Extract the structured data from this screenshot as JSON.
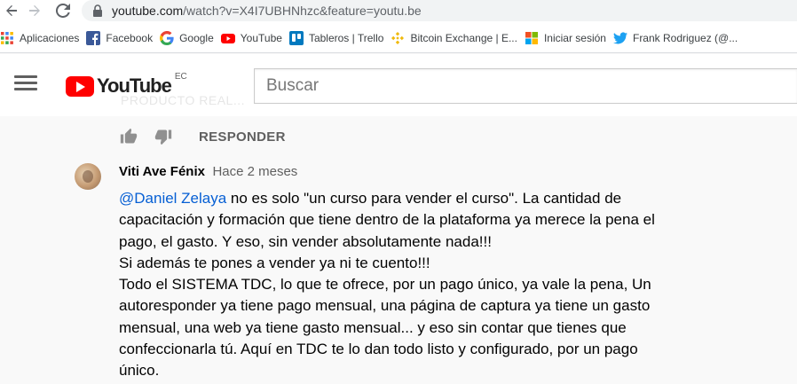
{
  "browser": {
    "url_host": "youtube.com",
    "url_path": "/watch?v=X4I7UBHNhzc&feature=youtu.be"
  },
  "bookmarks": [
    {
      "label": "Aplicaciones",
      "icon": "apps-grid-icon"
    },
    {
      "label": "Facebook",
      "icon": "facebook-icon"
    },
    {
      "label": "Google",
      "icon": "google-icon"
    },
    {
      "label": "YouTube",
      "icon": "youtube-icon"
    },
    {
      "label": "Tableros | Trello",
      "icon": "trello-icon"
    },
    {
      "label": "Bitcoin Exchange | E...",
      "icon": "binance-icon"
    },
    {
      "label": "Iniciar sesión",
      "icon": "microsoft-icon"
    },
    {
      "label": "Frank Rodriguez (@...",
      "icon": "twitter-icon"
    }
  ],
  "masthead": {
    "logo_text": "YouTube",
    "country_code": "EC",
    "search_placeholder": "Buscar",
    "ghost_text": "PRODUCTO REAL..."
  },
  "previous_comment_actions": {
    "reply_label": "RESPONDER"
  },
  "comment": {
    "author": "Viti Ave Fénix",
    "time": "Hace 2 meses",
    "mention": "@Daniel Zelaya",
    "text_after_mention": " no es solo \"un curso para vender el curso\". La cantidad de capacitación y formación que tiene dentro de la plataforma ya merece la pena el pago, el gasto. Y eso, sin vender absolutamente nada!!!",
    "line2": "Si además te pones a vender ya ni te cuento!!!",
    "line3": "Todo el SISTEMA TDC, lo que te ofrece, por un pago único, ya vale la pena, Un autoresponder ya tiene pago mensual, una página de captura ya tiene un gasto mensual, una web ya tiene gasto mensual... y eso sin contar que tienes que confeccionarla tú. Aquí en TDC te lo dan todo listo y configurado, por un pago único."
  },
  "colors": {
    "youtube_red": "#ff0000",
    "link_blue": "#065fd4",
    "secondary_text": "#606060"
  }
}
